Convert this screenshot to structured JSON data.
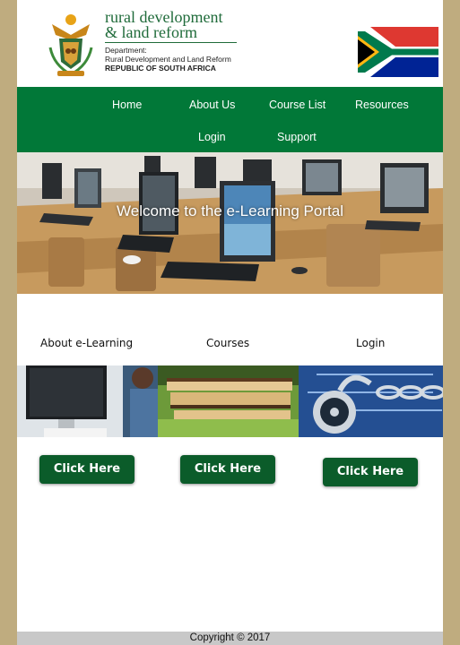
{
  "header": {
    "brand_title": "rural development\n& land reform",
    "department": "Department:\nRural Development and Land Reform",
    "country": "REPUBLIC OF SOUTH AFRICA"
  },
  "nav": {
    "items": [
      "Home",
      "About Us",
      "Course List",
      "Resources",
      "Login",
      "Support"
    ]
  },
  "hero": {
    "title": "Welcome to the e-Learning Portal"
  },
  "sections": [
    {
      "label": "About e-Learning",
      "button": "Click Here"
    },
    {
      "label": "Courses",
      "button": "Click Here"
    },
    {
      "label": "Login",
      "button": "Click Here"
    }
  ],
  "footer": {
    "copyright": "Copyright © 2017"
  },
  "colors": {
    "nav_green": "#017838",
    "button_green": "#0b5c2a",
    "brand_green": "#1f6b3a",
    "outer_background": "#bfac7f"
  }
}
